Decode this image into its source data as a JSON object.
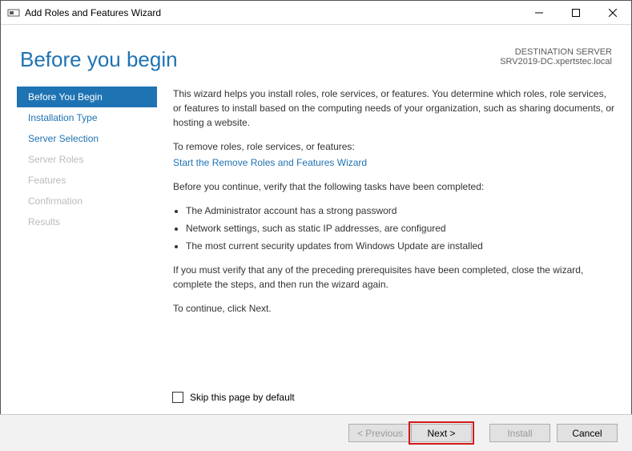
{
  "window": {
    "title": "Add Roles and Features Wizard"
  },
  "header": {
    "page_title": "Before you begin",
    "dest_label": "DESTINATION SERVER",
    "dest_value": "SRV2019-DC.xpertstec.local"
  },
  "sidebar": {
    "items": [
      {
        "label": "Before You Begin"
      },
      {
        "label": "Installation Type"
      },
      {
        "label": "Server Selection"
      },
      {
        "label": "Server Roles"
      },
      {
        "label": "Features"
      },
      {
        "label": "Confirmation"
      },
      {
        "label": "Results"
      }
    ]
  },
  "main": {
    "intro": "This wizard helps you install roles, role services, or features. You determine which roles, role services, or features to install based on the computing needs of your organization, such as sharing documents, or hosting a website.",
    "remove_lead": "To remove roles, role services, or features:",
    "remove_link": "Start the Remove Roles and Features Wizard",
    "verify_lead": "Before you continue, verify that the following tasks have been completed:",
    "bullets": [
      "The Administrator account has a strong password",
      "Network settings, such as static IP addresses, are configured",
      "The most current security updates from Windows Update are installed"
    ],
    "prereq_note": "If you must verify that any of the preceding prerequisites have been completed, close the wizard, complete the steps, and then run the wizard again.",
    "continue_note": "To continue, click Next.",
    "skip_label": "Skip this page by default"
  },
  "footer": {
    "previous": "< Previous",
    "next": "Next >",
    "install": "Install",
    "cancel": "Cancel"
  }
}
